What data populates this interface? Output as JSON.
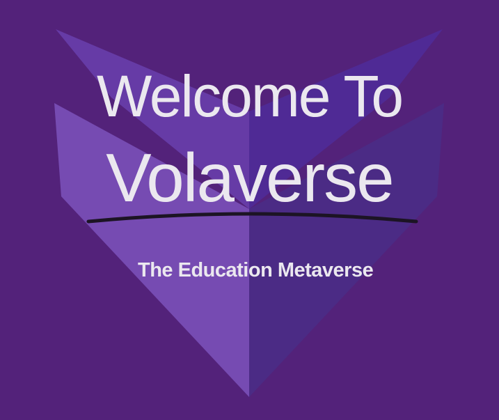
{
  "hero": {
    "title_line1": "Welcome To",
    "title_line2": "Volaverse",
    "tagline": "The Education Metaverse"
  },
  "colors": {
    "background": "#53227a",
    "text": "#ebe8ef",
    "underline": "#1c1424",
    "shape_light": "#7b52b3",
    "shape_mid": "#6b41a8",
    "shape_dark": "#4d2c8a"
  },
  "icons": {
    "logo_mark": "chevron-shield-logo"
  }
}
